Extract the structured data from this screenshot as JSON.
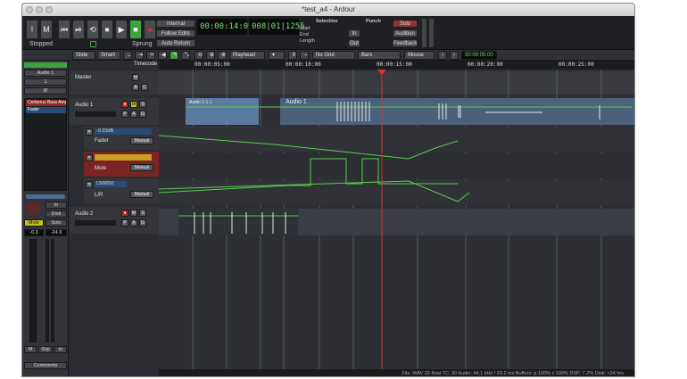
{
  "window": {
    "title": "*test_a4 - Ardour"
  },
  "transport": {
    "buttons": [
      "!",
      "M",
      "⏮",
      "⏯",
      "⟲",
      "⏹",
      "▶",
      "■",
      "●"
    ],
    "internal": "Internal",
    "follow_edits": "Follow Edits",
    "auto_return": "Auto Return",
    "clock_primary": "00:00:14:09",
    "clock_secondary": "008|01|1255",
    "selection": "Selection",
    "start": "Start",
    "end": "End",
    "length": "Length",
    "punch": "Punch",
    "in": "In",
    "out": "Out",
    "solo": "Solo",
    "audition": "Audition",
    "feedback": "Feedback",
    "stopped": "Stopped",
    "sprung": "Sprung"
  },
  "toolbar": {
    "slide": "Slide",
    "smart": "Smart",
    "playhead": "Playhead",
    "no_grid": "No Grid",
    "bars": "Bars",
    "mouse": "Mouse",
    "nudge_clock": "00:00:05:00"
  },
  "strip": {
    "name": "Audio 1",
    "input": "1",
    "phase": "Ø",
    "plugin": "Cerberus Bass Amp",
    "fader": "Fader",
    "in": "In",
    "disk": "Disk",
    "mute": "Mute",
    "solo": "Solo",
    "gain": "-0.3",
    "peak": "-24.9",
    "m": "M",
    "grp": "Grp",
    "io_in": "in",
    "comments": "Comments"
  },
  "tracks": {
    "timecode": "Timecode",
    "master": {
      "name": "Master",
      "m": "M",
      "a": "A",
      "c": "C"
    },
    "audio1": {
      "name": "Audio 1",
      "p": "P",
      "a": "A",
      "g": "G",
      "m": "M",
      "s": "S"
    },
    "auto_fader": {
      "value": "-0.33dB",
      "label": "Fader",
      "mode": "Manual"
    },
    "auto_mute": {
      "label": "Mute",
      "mode": "Manual"
    },
    "auto_pan": {
      "value": "L50R50",
      "label": "L/R",
      "mode": "Manual"
    },
    "audio2": {
      "name": "Audio 2",
      "p": "P",
      "a": "A",
      "g": "G",
      "m": "M",
      "s": "S"
    }
  },
  "ruler": {
    "marks": [
      "00:00:05:00",
      "00:00:10:00",
      "00:00:15:00",
      "00:00:20:00",
      "00:00:25:00"
    ]
  },
  "regions": {
    "audio1_region1": "Audio 1-1.1",
    "audio1_region2": "Audio 1"
  },
  "statusbar": {
    "text": "File: WAV 32-float  TC: 30  Audio: 44.1 kHz / 23.2 ms  Buffers: p:100% c:100%  DSP: 7.2%  Disk: >24 hrs"
  },
  "colors": {
    "accent_green": "#6ee06e",
    "playhead": "#e03030",
    "region": "#5a7aa0",
    "automation": "#55d04a"
  }
}
